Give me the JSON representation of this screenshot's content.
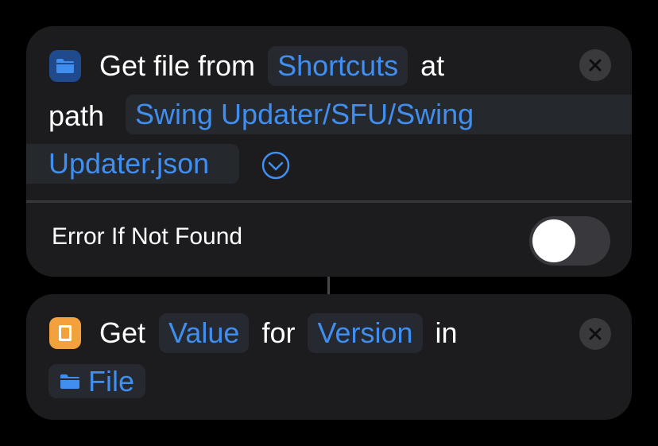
{
  "action1": {
    "icon": "folder-icon",
    "words": [
      "Get file from",
      "at",
      "path"
    ],
    "service": "Shortcuts",
    "path_line1": "Swing Updater/SFU/Swing",
    "path_line2": "Updater.json",
    "option_label": "Error If Not Found",
    "toggle_on": false
  },
  "action2": {
    "icon": "dictionary-icon",
    "words": [
      "Get",
      "for",
      "in"
    ],
    "value_token": "Value",
    "key_token": "Version",
    "input_variable": "File",
    "input_variable_icon": "folder-icon"
  },
  "colors": {
    "background": "#000000",
    "card": "#1c1c1e",
    "accent_blue": "#3f8ef0",
    "token_bg": "#26292f",
    "dict_icon": "#f3a13c",
    "files_icon": "#1f4b8e"
  }
}
